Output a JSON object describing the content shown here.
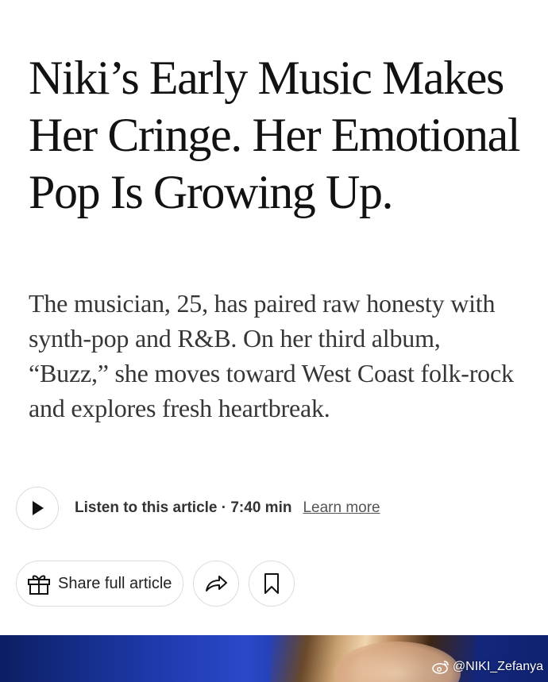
{
  "article": {
    "headline": "Niki’s Early Music Makes Her Cringe. Her Emotional Pop Is Growing Up.",
    "summary": "The musician, 25, has paired raw honesty with synth-pop and R&B. On her third album, “Buzz,” she moves toward West Coast folk-rock and explores fresh heartbreak."
  },
  "audio": {
    "listen_text": "Listen to this article · 7:40 min",
    "learn_more": "Learn more"
  },
  "actions": {
    "share_label": "Share full article"
  },
  "watermark": {
    "text": "@NIKI_Zefanya"
  },
  "icons": {
    "play": "play-icon",
    "gift": "gift-icon",
    "share": "share-arrow-icon",
    "bookmark": "bookmark-icon",
    "weibo": "weibo-icon"
  },
  "colors": {
    "headline": "#121212",
    "summary": "#363636",
    "border": "#dcdcdc"
  }
}
